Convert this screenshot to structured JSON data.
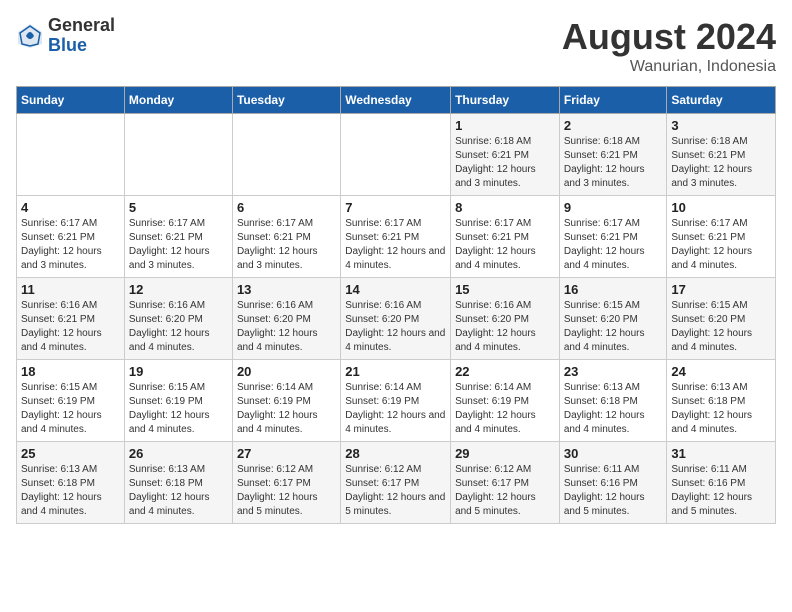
{
  "logo": {
    "general": "General",
    "blue": "Blue"
  },
  "header": {
    "month_year": "August 2024",
    "location": "Wanurian, Indonesia"
  },
  "weekdays": [
    "Sunday",
    "Monday",
    "Tuesday",
    "Wednesday",
    "Thursday",
    "Friday",
    "Saturday"
  ],
  "weeks": [
    [
      {
        "day": "",
        "info": ""
      },
      {
        "day": "",
        "info": ""
      },
      {
        "day": "",
        "info": ""
      },
      {
        "day": "",
        "info": ""
      },
      {
        "day": "1",
        "info": "Sunrise: 6:18 AM\nSunset: 6:21 PM\nDaylight: 12 hours and 3 minutes."
      },
      {
        "day": "2",
        "info": "Sunrise: 6:18 AM\nSunset: 6:21 PM\nDaylight: 12 hours and 3 minutes."
      },
      {
        "day": "3",
        "info": "Sunrise: 6:18 AM\nSunset: 6:21 PM\nDaylight: 12 hours and 3 minutes."
      }
    ],
    [
      {
        "day": "4",
        "info": "Sunrise: 6:17 AM\nSunset: 6:21 PM\nDaylight: 12 hours and 3 minutes."
      },
      {
        "day": "5",
        "info": "Sunrise: 6:17 AM\nSunset: 6:21 PM\nDaylight: 12 hours and 3 minutes."
      },
      {
        "day": "6",
        "info": "Sunrise: 6:17 AM\nSunset: 6:21 PM\nDaylight: 12 hours and 3 minutes."
      },
      {
        "day": "7",
        "info": "Sunrise: 6:17 AM\nSunset: 6:21 PM\nDaylight: 12 hours and 4 minutes."
      },
      {
        "day": "8",
        "info": "Sunrise: 6:17 AM\nSunset: 6:21 PM\nDaylight: 12 hours and 4 minutes."
      },
      {
        "day": "9",
        "info": "Sunrise: 6:17 AM\nSunset: 6:21 PM\nDaylight: 12 hours and 4 minutes."
      },
      {
        "day": "10",
        "info": "Sunrise: 6:17 AM\nSunset: 6:21 PM\nDaylight: 12 hours and 4 minutes."
      }
    ],
    [
      {
        "day": "11",
        "info": "Sunrise: 6:16 AM\nSunset: 6:21 PM\nDaylight: 12 hours and 4 minutes."
      },
      {
        "day": "12",
        "info": "Sunrise: 6:16 AM\nSunset: 6:20 PM\nDaylight: 12 hours and 4 minutes."
      },
      {
        "day": "13",
        "info": "Sunrise: 6:16 AM\nSunset: 6:20 PM\nDaylight: 12 hours and 4 minutes."
      },
      {
        "day": "14",
        "info": "Sunrise: 6:16 AM\nSunset: 6:20 PM\nDaylight: 12 hours and 4 minutes."
      },
      {
        "day": "15",
        "info": "Sunrise: 6:16 AM\nSunset: 6:20 PM\nDaylight: 12 hours and 4 minutes."
      },
      {
        "day": "16",
        "info": "Sunrise: 6:15 AM\nSunset: 6:20 PM\nDaylight: 12 hours and 4 minutes."
      },
      {
        "day": "17",
        "info": "Sunrise: 6:15 AM\nSunset: 6:20 PM\nDaylight: 12 hours and 4 minutes."
      }
    ],
    [
      {
        "day": "18",
        "info": "Sunrise: 6:15 AM\nSunset: 6:19 PM\nDaylight: 12 hours and 4 minutes."
      },
      {
        "day": "19",
        "info": "Sunrise: 6:15 AM\nSunset: 6:19 PM\nDaylight: 12 hours and 4 minutes."
      },
      {
        "day": "20",
        "info": "Sunrise: 6:14 AM\nSunset: 6:19 PM\nDaylight: 12 hours and 4 minutes."
      },
      {
        "day": "21",
        "info": "Sunrise: 6:14 AM\nSunset: 6:19 PM\nDaylight: 12 hours and 4 minutes."
      },
      {
        "day": "22",
        "info": "Sunrise: 6:14 AM\nSunset: 6:19 PM\nDaylight: 12 hours and 4 minutes."
      },
      {
        "day": "23",
        "info": "Sunrise: 6:13 AM\nSunset: 6:18 PM\nDaylight: 12 hours and 4 minutes."
      },
      {
        "day": "24",
        "info": "Sunrise: 6:13 AM\nSunset: 6:18 PM\nDaylight: 12 hours and 4 minutes."
      }
    ],
    [
      {
        "day": "25",
        "info": "Sunrise: 6:13 AM\nSunset: 6:18 PM\nDaylight: 12 hours and 4 minutes."
      },
      {
        "day": "26",
        "info": "Sunrise: 6:13 AM\nSunset: 6:18 PM\nDaylight: 12 hours and 4 minutes."
      },
      {
        "day": "27",
        "info": "Sunrise: 6:12 AM\nSunset: 6:17 PM\nDaylight: 12 hours and 5 minutes."
      },
      {
        "day": "28",
        "info": "Sunrise: 6:12 AM\nSunset: 6:17 PM\nDaylight: 12 hours and 5 minutes."
      },
      {
        "day": "29",
        "info": "Sunrise: 6:12 AM\nSunset: 6:17 PM\nDaylight: 12 hours and 5 minutes."
      },
      {
        "day": "30",
        "info": "Sunrise: 6:11 AM\nSunset: 6:16 PM\nDaylight: 12 hours and 5 minutes."
      },
      {
        "day": "31",
        "info": "Sunrise: 6:11 AM\nSunset: 6:16 PM\nDaylight: 12 hours and 5 minutes."
      }
    ]
  ]
}
